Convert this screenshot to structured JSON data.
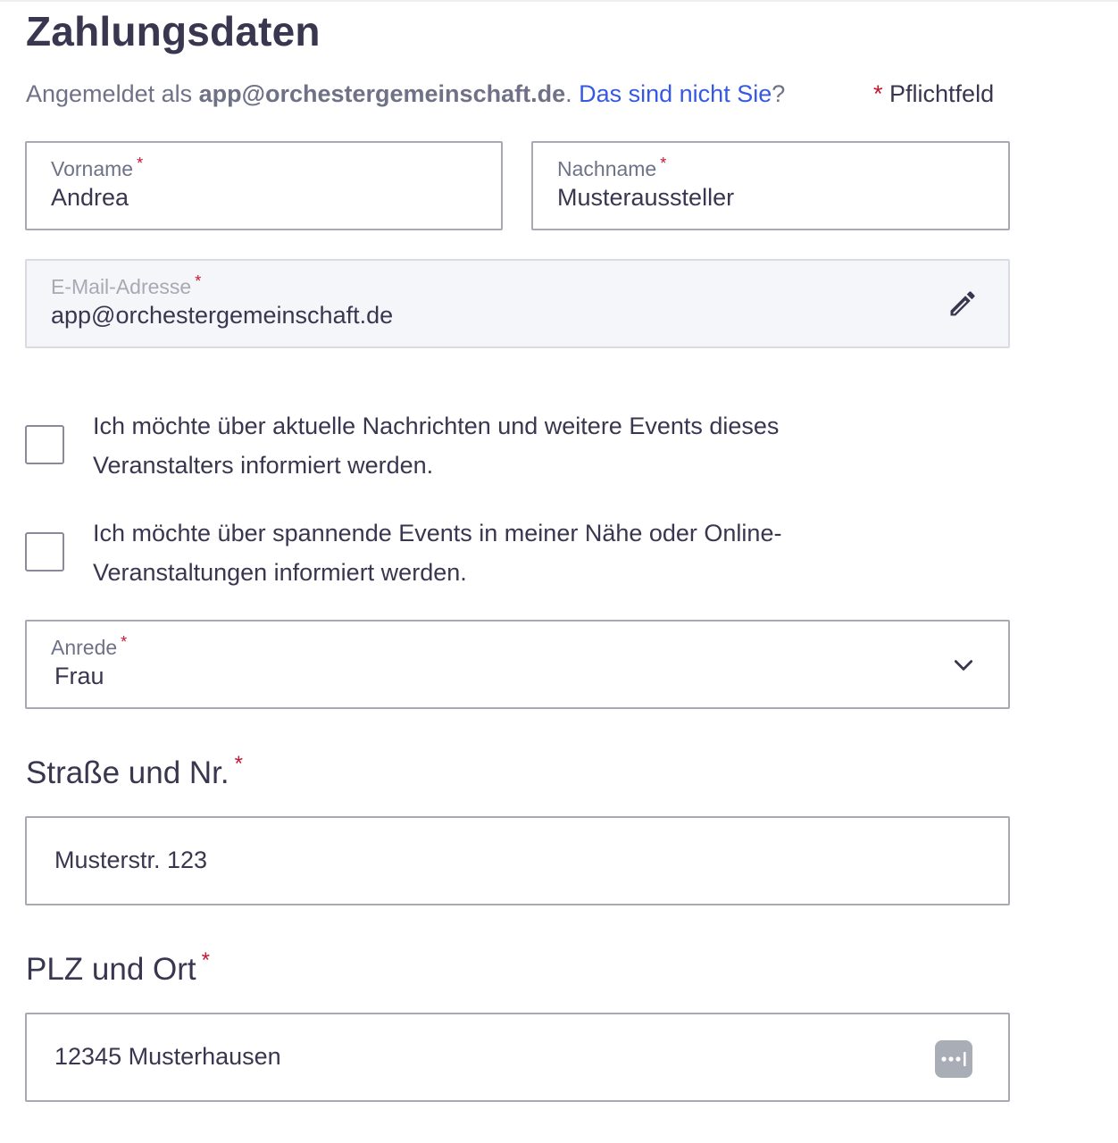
{
  "header": {
    "title": "Zahlungsdaten",
    "logged_in_prefix": "Angemeldet als",
    "logged_in_email": "app@orchestergemeinschaft.de",
    "not_you_link": "Das sind nicht Sie",
    "required_star": "*",
    "required_label": "Pflichtfeld"
  },
  "form": {
    "first_name": {
      "label": "Vorname",
      "value": "Andrea"
    },
    "last_name": {
      "label": "Nachname",
      "value": "Musteraussteller"
    },
    "email": {
      "label": "E-Mail-Adresse",
      "value": "app@orchestergemeinschaft.de",
      "icon": "pencil-icon"
    },
    "checkbox_organizer_news": {
      "label": "Ich möchte über aktuelle Nachrichten und weitere Events dieses Veranstalters informiert werden.",
      "checked": false
    },
    "checkbox_nearby_events": {
      "label": "Ich möchte über spannende Events in meiner Nähe oder Online-Veranstaltungen informiert werden.",
      "checked": false
    },
    "salutation": {
      "label": "Anrede",
      "value": "Frau",
      "icon": "chevron-down-icon"
    },
    "street": {
      "label": "Straße und Nr.",
      "value": "Musterstr. 123"
    },
    "zip_city": {
      "label": "PLZ und Ort",
      "value": "12345 Musterhausen",
      "icon": "password-manager-icon"
    }
  },
  "colors": {
    "text": "#39364f",
    "muted": "#6f7287",
    "link": "#3659e3",
    "required": "#c5162e",
    "border": "#a9a8b3"
  }
}
